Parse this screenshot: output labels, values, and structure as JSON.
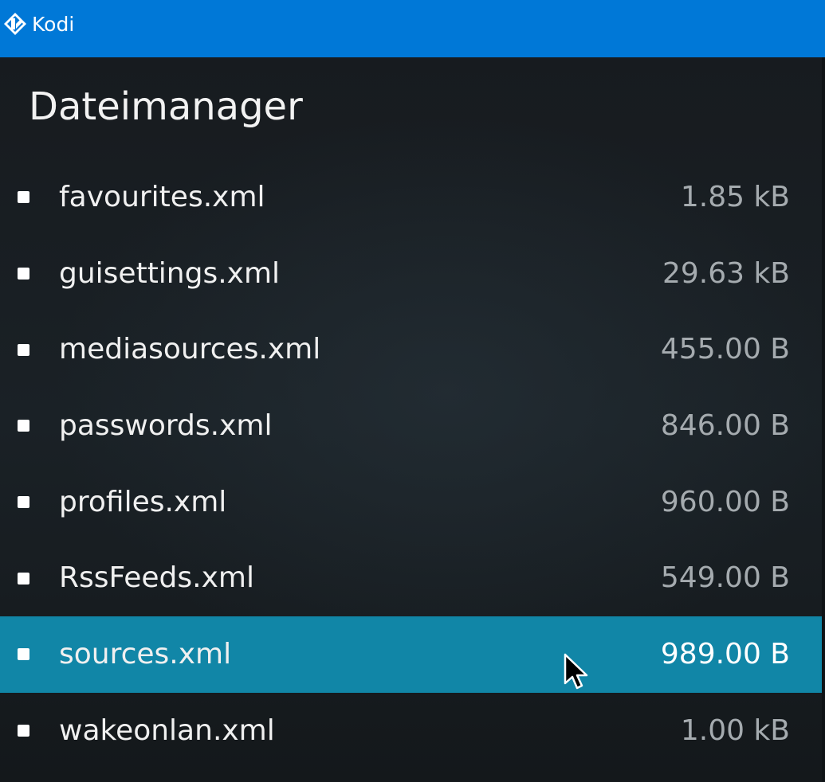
{
  "window": {
    "title": "Kodi",
    "titlebar_color": "#0078d7",
    "logo_icon": "kodi-logo-icon"
  },
  "page": {
    "title": "Dateimanager"
  },
  "files": [
    {
      "name": "favourites.xml",
      "size": "1.85 kB"
    },
    {
      "name": "guisettings.xml",
      "size": "29.63 kB"
    },
    {
      "name": "mediasources.xml",
      "size": "455.00 B"
    },
    {
      "name": "passwords.xml",
      "size": "846.00 B"
    },
    {
      "name": "profiles.xml",
      "size": "960.00 B"
    },
    {
      "name": "RssFeeds.xml",
      "size": "549.00 B"
    },
    {
      "name": "sources.xml",
      "size": "989.00 B",
      "selected": true
    },
    {
      "name": "wakeonlan.xml",
      "size": "1.00 kB"
    }
  ],
  "colors": {
    "selection": "#1186a7",
    "background": "#15191d",
    "size_text": "#a5abaf"
  }
}
